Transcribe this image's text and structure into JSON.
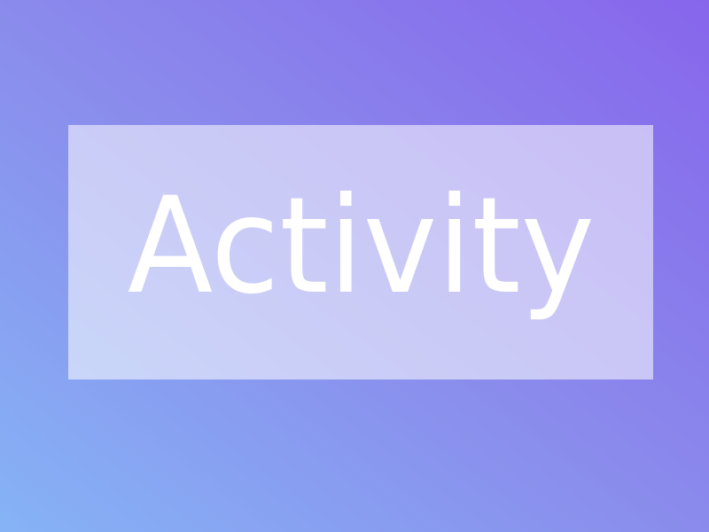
{
  "title": {
    "text": "Activity"
  },
  "colors": {
    "gradient_top_right": "#8766ec",
    "gradient_bottom_left": "#86b3f6",
    "panel": "#c6c7f6",
    "text": "#ffffff"
  }
}
